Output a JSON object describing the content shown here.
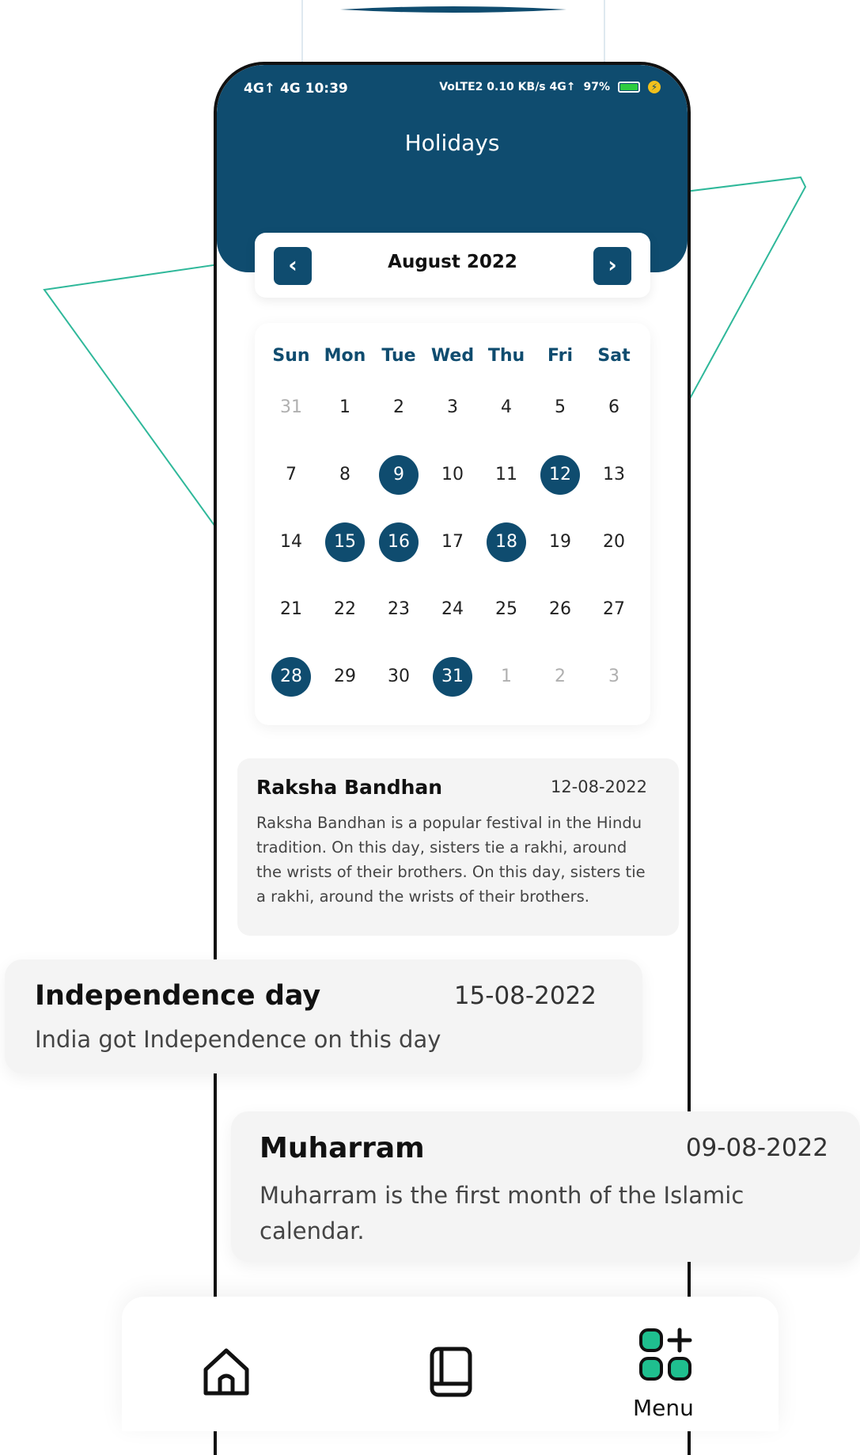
{
  "status_bar": {
    "left": "4G↑ 4G 10:39",
    "right_network": "VoLTE2 0.10 KB/s 4G↑",
    "battery_percent": "97%"
  },
  "page_title": "Holidays",
  "calendar": {
    "month_label": "August 2022",
    "weekdays": [
      "Sun",
      "Mon",
      "Tue",
      "Wed",
      "Thu",
      "Fri",
      "Sat"
    ],
    "days": [
      {
        "label": "31",
        "muted": true,
        "holiday": false
      },
      {
        "label": "1",
        "muted": false,
        "holiday": false
      },
      {
        "label": "2",
        "muted": false,
        "holiday": false
      },
      {
        "label": "3",
        "muted": false,
        "holiday": false
      },
      {
        "label": "4",
        "muted": false,
        "holiday": false
      },
      {
        "label": "5",
        "muted": false,
        "holiday": false
      },
      {
        "label": "6",
        "muted": false,
        "holiday": false
      },
      {
        "label": "7",
        "muted": false,
        "holiday": false
      },
      {
        "label": "8",
        "muted": false,
        "holiday": false
      },
      {
        "label": "9",
        "muted": false,
        "holiday": true
      },
      {
        "label": "10",
        "muted": false,
        "holiday": false
      },
      {
        "label": "11",
        "muted": false,
        "holiday": false
      },
      {
        "label": "12",
        "muted": false,
        "holiday": true
      },
      {
        "label": "13",
        "muted": false,
        "holiday": false
      },
      {
        "label": "14",
        "muted": false,
        "holiday": false
      },
      {
        "label": "15",
        "muted": false,
        "holiday": true
      },
      {
        "label": "16",
        "muted": false,
        "holiday": true
      },
      {
        "label": "17",
        "muted": false,
        "holiday": false
      },
      {
        "label": "18",
        "muted": false,
        "holiday": true
      },
      {
        "label": "19",
        "muted": false,
        "holiday": false
      },
      {
        "label": "20",
        "muted": false,
        "holiday": false
      },
      {
        "label": "21",
        "muted": false,
        "holiday": false
      },
      {
        "label": "22",
        "muted": false,
        "holiday": false
      },
      {
        "label": "23",
        "muted": false,
        "holiday": false
      },
      {
        "label": "24",
        "muted": false,
        "holiday": false
      },
      {
        "label": "25",
        "muted": false,
        "holiday": false
      },
      {
        "label": "26",
        "muted": false,
        "holiday": false
      },
      {
        "label": "27",
        "muted": false,
        "holiday": false
      },
      {
        "label": "28",
        "muted": false,
        "holiday": true
      },
      {
        "label": "29",
        "muted": false,
        "holiday": false
      },
      {
        "label": "30",
        "muted": false,
        "holiday": false
      },
      {
        "label": "31",
        "muted": false,
        "holiday": true
      },
      {
        "label": "1",
        "muted": true,
        "holiday": false
      },
      {
        "label": "2",
        "muted": true,
        "holiday": false
      },
      {
        "label": "3",
        "muted": true,
        "holiday": false
      }
    ]
  },
  "events": [
    {
      "title": "Raksha Bandhan",
      "date": "12-08-2022",
      "description": "Raksha Bandhan is a popular festival in the Hindu tradition.  On this day, sisters tie a rakhi, around the wrists of their brothers. On this day, sisters tie a rakhi, around the wrists of their brothers."
    },
    {
      "title": "Independence day",
      "date": "15-08-2022",
      "description": "India got Independence on this day"
    },
    {
      "title": "Muharram",
      "date": "09-08-2022",
      "description": "Muharram is the first month of the Islamic calendar."
    }
  ],
  "bottom_nav": {
    "items": [
      {
        "icon": "home-icon",
        "label": ""
      },
      {
        "icon": "book-icon",
        "label": ""
      },
      {
        "icon": "menu-grid-icon",
        "label": "Menu"
      }
    ]
  },
  "colors": {
    "primary": "#0f4c6f",
    "accent_green": "#1fbf8f",
    "card_bg": "#f4f4f4"
  }
}
